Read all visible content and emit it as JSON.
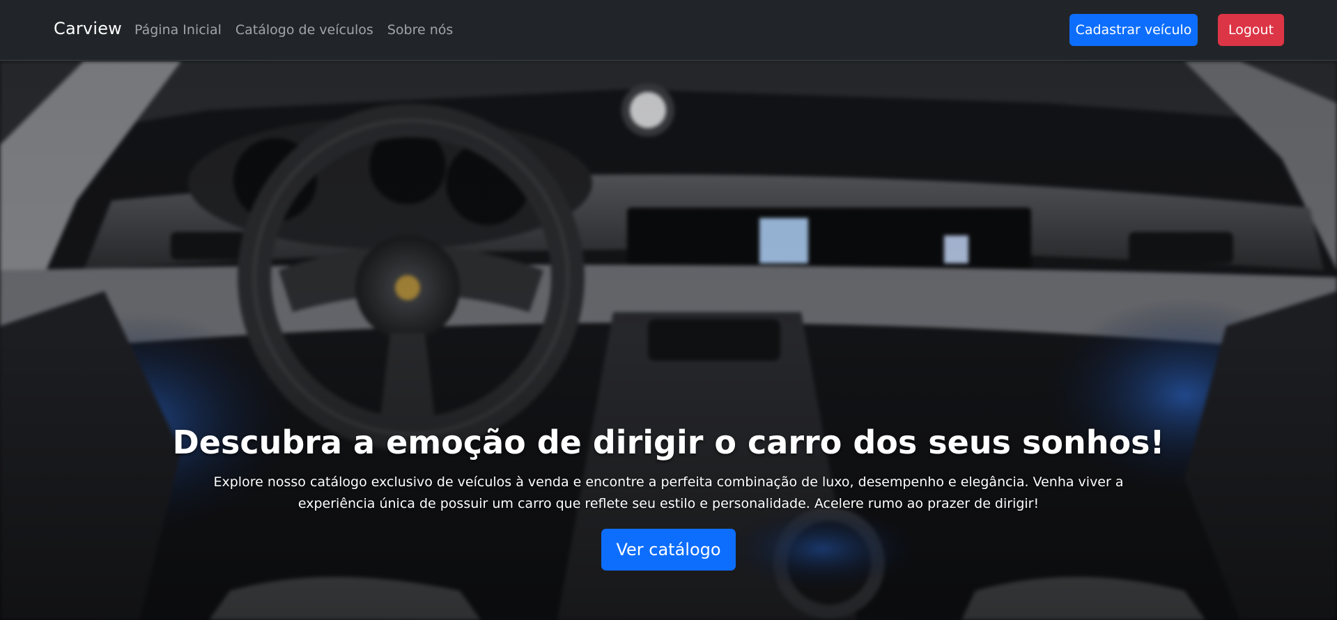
{
  "navbar": {
    "brand": "Carview",
    "links": [
      {
        "label": "Página Inicial"
      },
      {
        "label": "Catálogo de veículos"
      },
      {
        "label": "Sobre nós"
      }
    ],
    "register_button": "Cadastrar veículo",
    "logout_button": "Logout"
  },
  "hero": {
    "title": "Descubra a emoção de dirigir o carro dos seus sonhos!",
    "text": "Explore nosso catálogo exclusivo de veículos à venda e encontre a perfeita combinação de luxo, desempenho e elegância. Venha viver a experiência única de possuir um carro que reflete seu estilo e personalidade. Acelere rumo ao prazer de dirigir!",
    "cta_button": "Ver catálogo",
    "image_description": "car-interior-dashboard-image"
  },
  "colors": {
    "navbar_bg": "#212529",
    "primary": "#0d6efd",
    "danger": "#dc3545"
  }
}
